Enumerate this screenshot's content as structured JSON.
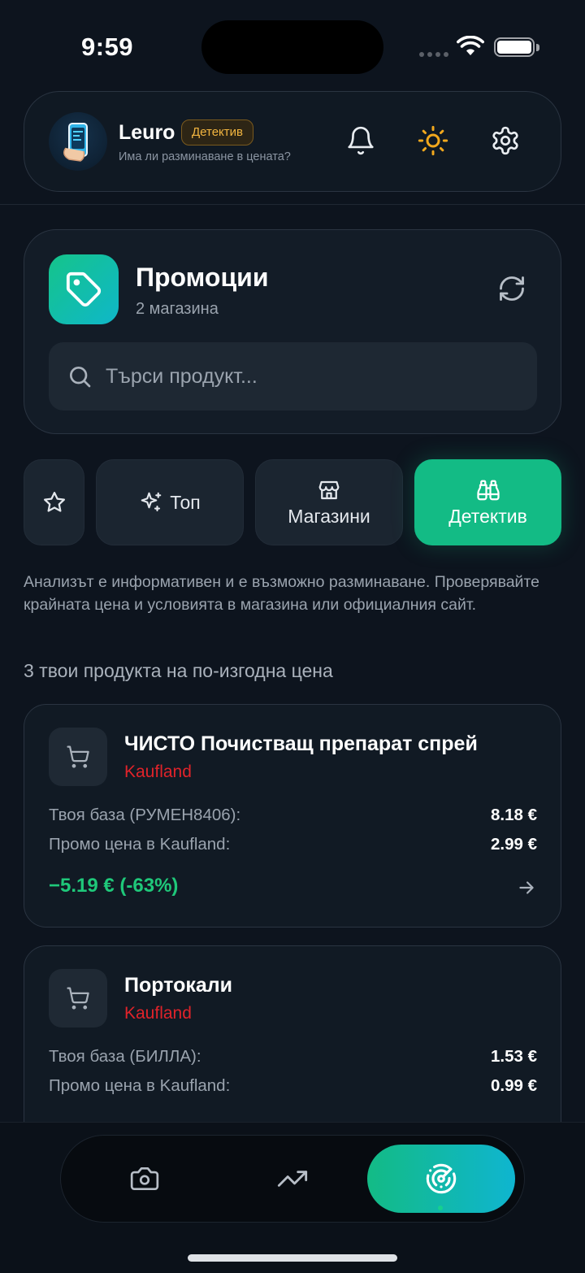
{
  "status_bar": {
    "time": "9:59"
  },
  "header": {
    "app_name": "Leuro",
    "badge": "Детектив",
    "tagline": "Има ли разминаване в цената?"
  },
  "promo": {
    "title": "Промоции",
    "subtitle": "2 магазина",
    "search_placeholder": "Търси продукт..."
  },
  "tabs": [
    {
      "label": "",
      "icon": "star-icon"
    },
    {
      "label": "Топ",
      "icon": "sparkles-icon"
    },
    {
      "label": "Магазини",
      "icon": "store-icon"
    },
    {
      "label": "Детектив",
      "icon": "binoculars-icon",
      "active": true
    }
  ],
  "disclaimer": "Анализът е информативен и е възможно разминаване. Проверявайте крайната цена и условията в магазина или официалния сайт.",
  "section_title": "3 твои продукта на по-изгодна цена",
  "products": [
    {
      "name": "ЧИСТО Почистващ препарат спрей",
      "store": "Kaufland",
      "base_label": "Твоя база (РУМЕН8406):",
      "base_price": "8.18 €",
      "promo_label": "Промо цена в Kaufland:",
      "promo_price": "2.99 €",
      "savings": "−5.19 € (-63%)"
    },
    {
      "name": "Портокали",
      "store": "Kaufland",
      "base_label": "Твоя база (БИЛЛА):",
      "base_price": "1.53 €",
      "promo_label": "Промо цена в Kaufland:",
      "promo_price": "0.99 €"
    }
  ],
  "bottom_nav": [
    {
      "icon": "camera-icon"
    },
    {
      "icon": "trending-up-icon"
    },
    {
      "icon": "radar-icon",
      "active": true
    }
  ],
  "colors": {
    "background": "#0d141e",
    "accent_green": "#13bb85",
    "accent_teal": "#0fb5d0",
    "store_red": "#e0232a",
    "savings_green": "#1fc87a",
    "badge_gold": "#f2b540",
    "sun_orange": "#f2a81d"
  }
}
